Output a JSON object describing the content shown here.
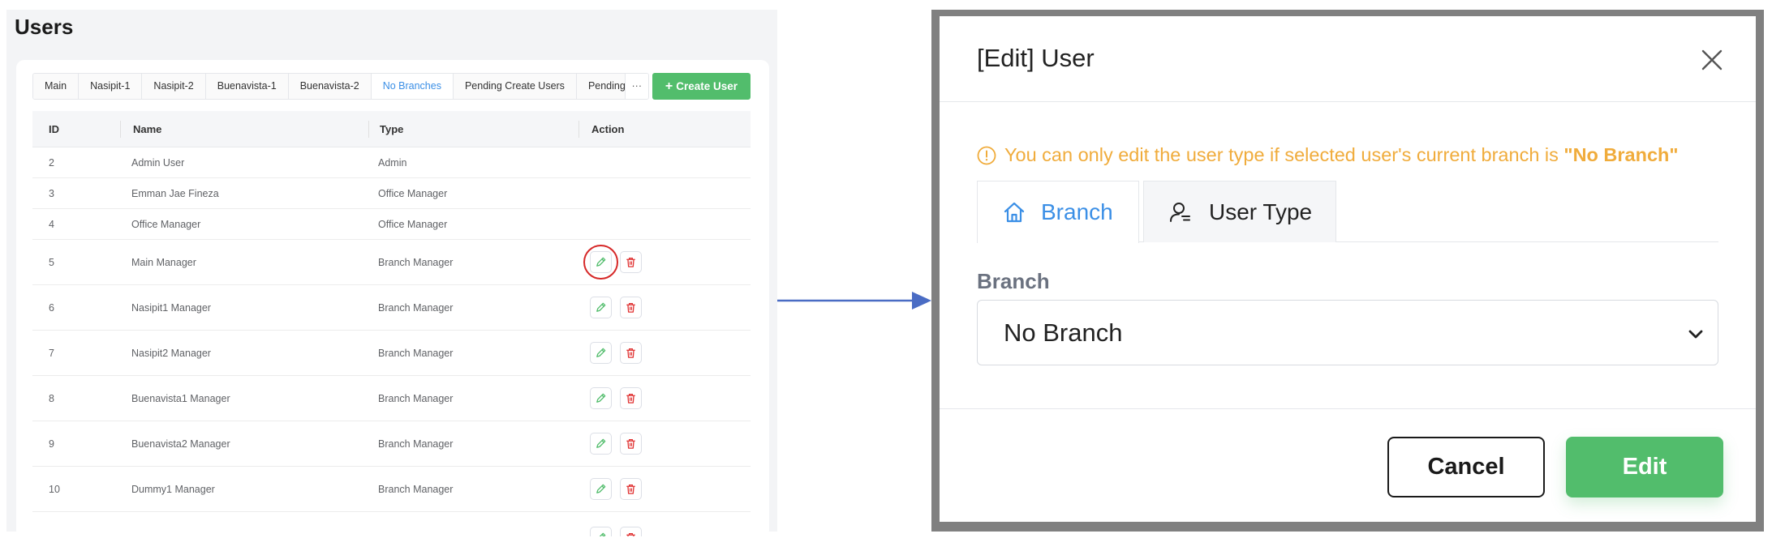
{
  "users_page": {
    "title": "Users",
    "tabs": [
      "Main",
      "Nasipit-1",
      "Nasipit-2",
      "Buenavista-1",
      "Buenavista-2",
      "No Branches",
      "Pending Create Users",
      "Pending E"
    ],
    "active_tab": "No Branches",
    "more_label": "···",
    "create_user_label": "Create User",
    "create_user_icon": "+",
    "columns": [
      "ID",
      "Name",
      "Type",
      "Action"
    ],
    "rows": [
      {
        "id": "2",
        "name": "Admin User",
        "type": "Admin"
      },
      {
        "id": "3",
        "name": "Emman Jae Fineza",
        "type": "Office Manager"
      },
      {
        "id": "4",
        "name": "Office Manager",
        "type": "Office Manager"
      },
      {
        "id": "5",
        "name": "Main Manager",
        "type": "Branch Manager"
      },
      {
        "id": "6",
        "name": "Nasipit1 Manager",
        "type": "Branch Manager"
      },
      {
        "id": "7",
        "name": "Nasipit2 Manager",
        "type": "Branch Manager"
      },
      {
        "id": "8",
        "name": "Buenavista1 Manager",
        "type": "Branch Manager"
      },
      {
        "id": "9",
        "name": "Buenavista2 Manager",
        "type": "Branch Manager"
      },
      {
        "id": "10",
        "name": "Dummy1 Manager",
        "type": "Branch Manager"
      }
    ]
  },
  "modal": {
    "title": "[Edit] User",
    "notice_prefix": "You can only edit the user type if selected user's current branch is ",
    "notice_emphasis": "\"No Branch\"",
    "tabs": {
      "branch": "Branch",
      "user_type": "User Type"
    },
    "branch_label": "Branch",
    "branch_value": "No Branch",
    "cancel_label": "Cancel",
    "edit_label": "Edit"
  },
  "colors": {
    "accent_green": "#52bd6c",
    "accent_blue": "#3b8fe6",
    "warning": "#f0ac3c",
    "danger": "#e03131",
    "arrow": "#4a6cc4"
  }
}
